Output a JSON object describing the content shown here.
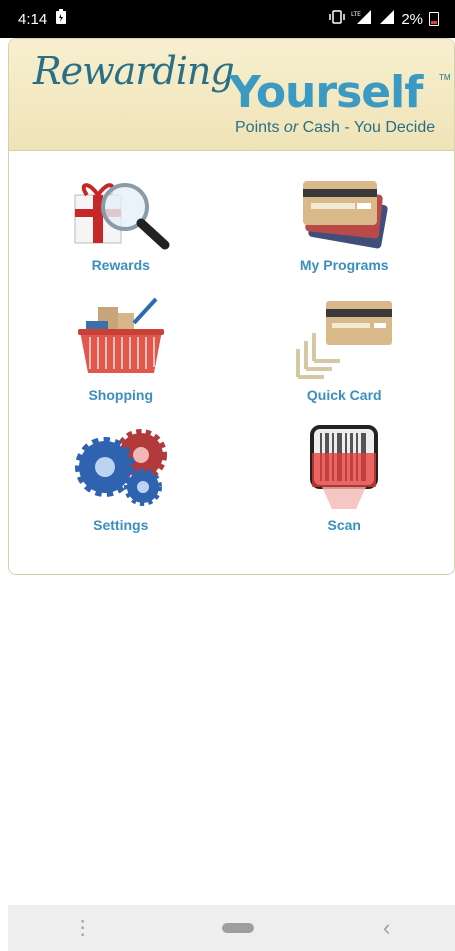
{
  "status": {
    "time": "4:14",
    "battery": "2%"
  },
  "logo": {
    "script": "Rewarding",
    "bold": "Yourself",
    "tm": "TM",
    "tagline_pre": "Points ",
    "tagline_or": "or",
    "tagline_post": " Cash - You Decide"
  },
  "menu": [
    {
      "label": "Rewards",
      "icon": "gift-magnifier-icon"
    },
    {
      "label": "My Programs",
      "icon": "credit-cards-icon"
    },
    {
      "label": "Shopping",
      "icon": "shopping-basket-icon"
    },
    {
      "label": "Quick Card",
      "icon": "quick-card-icon"
    },
    {
      "label": "Settings",
      "icon": "gears-icon"
    },
    {
      "label": "Scan",
      "icon": "barcode-scan-icon"
    }
  ],
  "colors": {
    "accent": "#3b8fbe",
    "logo_dark": "#2a6f86",
    "banner": "#f3e9c4"
  }
}
